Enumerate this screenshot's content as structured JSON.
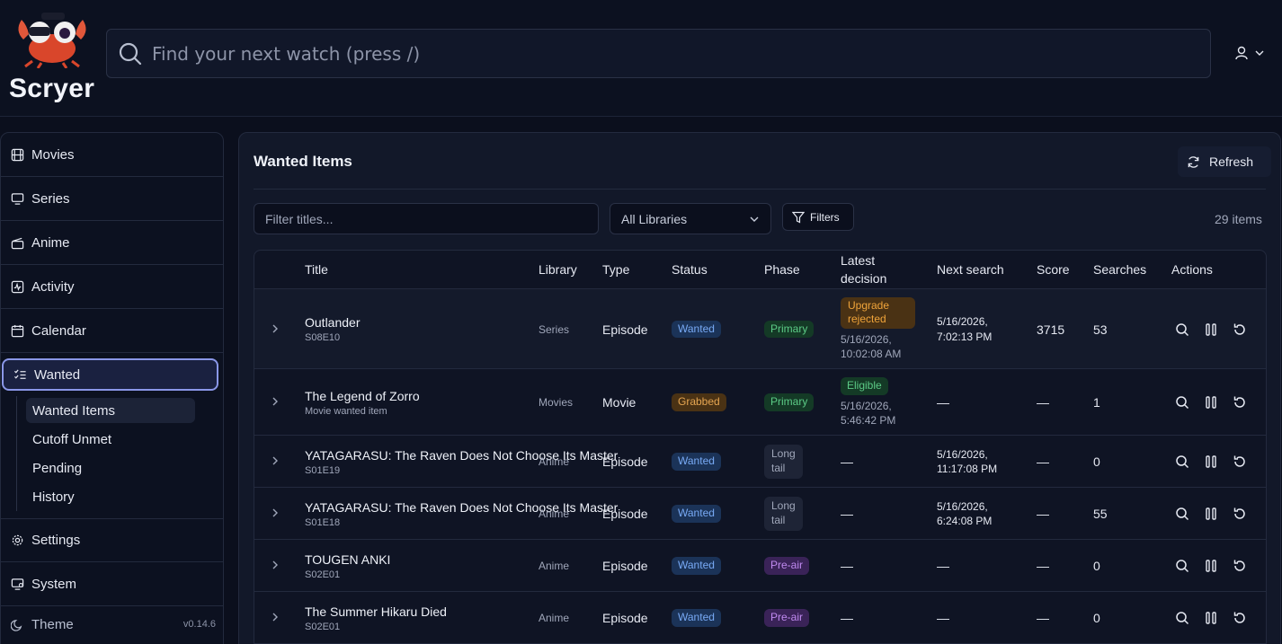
{
  "app": {
    "name": "Scryer",
    "version": "v0.14.6"
  },
  "search": {
    "placeholder": "Find your next watch (press /)"
  },
  "sidebar": {
    "items": [
      {
        "label": "Movies",
        "icon": "film-icon"
      },
      {
        "label": "Series",
        "icon": "monitor-icon"
      },
      {
        "label": "Anime",
        "icon": "clapperboard-icon"
      },
      {
        "label": "Activity",
        "icon": "activity-icon"
      },
      {
        "label": "Calendar",
        "icon": "calendar-icon"
      },
      {
        "label": "Wanted",
        "icon": "list-checks-icon"
      },
      {
        "label": "Settings",
        "icon": "gear-icon"
      },
      {
        "label": "System",
        "icon": "system-monitor-icon"
      }
    ],
    "wanted_sub": [
      "Wanted Items",
      "Cutoff Unmet",
      "Pending",
      "History"
    ],
    "theme_label": "Theme"
  },
  "panel": {
    "title": "Wanted Items",
    "refresh_label": "Refresh",
    "filter_placeholder": "Filter titles...",
    "library_select": "All Libraries",
    "filters_label": "Filters",
    "item_count": "29 items"
  },
  "table": {
    "headers": {
      "title": "Title",
      "library": "Library",
      "type": "Type",
      "status": "Status",
      "phase": "Phase",
      "latest_line1": "Latest",
      "latest_line2": "decision",
      "next": "Next search",
      "score": "Score",
      "searches": "Searches",
      "actions": "Actions"
    },
    "rows": [
      {
        "title": "Outlander",
        "sub": "S08E10",
        "library": "Series",
        "type": "Episode",
        "status": "Wanted",
        "phase": "Primary",
        "decision_badge": "Upgrade rejected",
        "decision_date1": "5/16/2026,",
        "decision_date2": "10:02:08 AM",
        "next1": "5/16/2026,",
        "next2": "7:02:13 PM",
        "score": "3715",
        "searches": "53"
      },
      {
        "title": "The Legend of Zorro",
        "sub": "Movie wanted item",
        "library": "Movies",
        "type": "Movie",
        "status": "Grabbed",
        "phase": "Primary",
        "decision_badge": "Eligible",
        "decision_date1": "5/16/2026,",
        "decision_date2": "5:46:42 PM",
        "next1": "—",
        "next2": "",
        "score": "—",
        "searches": "1"
      },
      {
        "title": "YATAGARASU: The Raven Does Not Choose Its Master",
        "sub": "S01E19",
        "library": "Anime",
        "type": "Episode",
        "status": "Wanted",
        "phase1": "Long",
        "phase2": "tail",
        "decision": "—",
        "next1": "5/16/2026,",
        "next2": "11:17:08 PM",
        "score": "—",
        "searches": "0"
      },
      {
        "title": "YATAGARASU: The Raven Does Not Choose Its Master",
        "sub": "S01E18",
        "library": "Anime",
        "type": "Episode",
        "status": "Wanted",
        "phase1": "Long",
        "phase2": "tail",
        "decision": "—",
        "next1": "5/16/2026,",
        "next2": "6:24:08 PM",
        "score": "—",
        "searches": "55"
      },
      {
        "title": "TOUGEN ANKI",
        "sub": "S02E01",
        "library": "Anime",
        "type": "Episode",
        "status": "Wanted",
        "phase": "Pre-air",
        "decision": "—",
        "next1": "—",
        "score": "—",
        "searches": "0"
      },
      {
        "title": "The Summer Hikaru Died",
        "sub": "S02E01",
        "library": "Anime",
        "type": "Episode",
        "status": "Wanted",
        "phase": "Pre-air",
        "decision": "—",
        "next1": "—",
        "score": "—",
        "searches": "0"
      }
    ]
  },
  "colors": {
    "accent": "#8a97e8",
    "background": "#0b0f1d",
    "panel": "#121829",
    "wanted": "#78aaf5",
    "grabbed": "#e5a551",
    "primary": "#5ccb86",
    "preair": "#c08af0"
  }
}
